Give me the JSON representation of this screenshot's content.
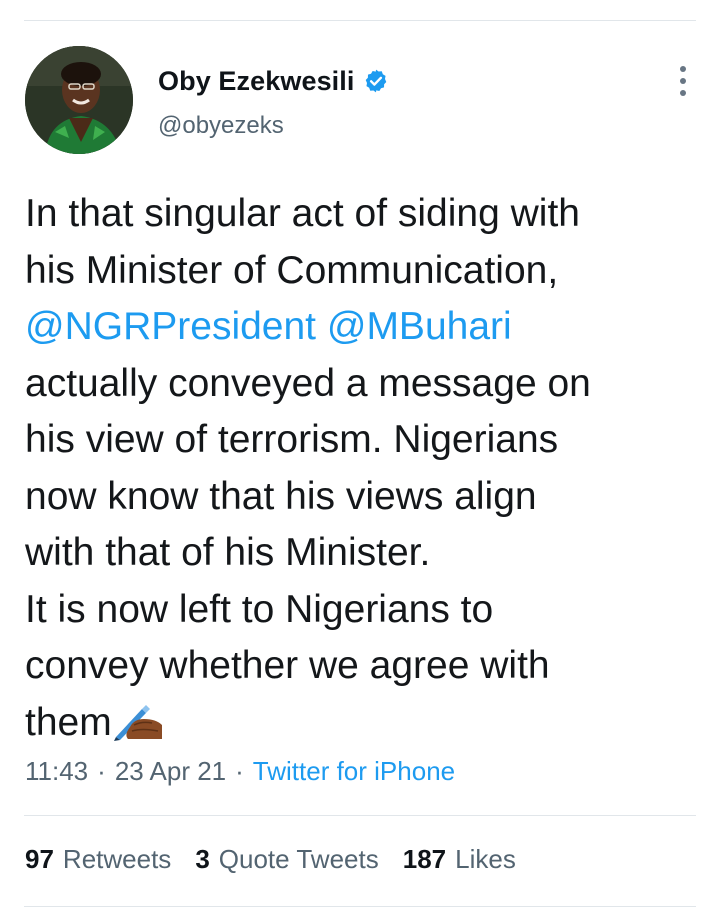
{
  "author": {
    "display_name": "Oby Ezekwesili",
    "handle": "@obyezeks",
    "verified": true,
    "avatar_icon": "profile-photo"
  },
  "tweet": {
    "line1": "In that singular act of siding with",
    "line2": "his Minister of Communication,",
    "mention1": "@NGRPresident",
    "mention2": "@MBuhari",
    "line4": "actually conveyed a message on",
    "line5": "his view of terrorism. Nigerians",
    "line6": "now know that his views align",
    "line7": "with that of his Minister.",
    "line8": "It is now left to Nigerians to",
    "line9": "convey whether we agree with",
    "line10": "them",
    "emoji_icon": "writing-hand-icon"
  },
  "meta": {
    "time": "11:43",
    "date": "23 Apr 21",
    "source": "Twitter for iPhone",
    "separator": "·"
  },
  "stats": {
    "retweets_count": "97",
    "retweets_label": "Retweets",
    "quotes_count": "3",
    "quotes_label": "Quote Tweets",
    "likes_count": "187",
    "likes_label": "Likes"
  },
  "colors": {
    "link": "#1d9bf0",
    "secondary_text": "#536471",
    "verified": "#1d9bf0"
  }
}
